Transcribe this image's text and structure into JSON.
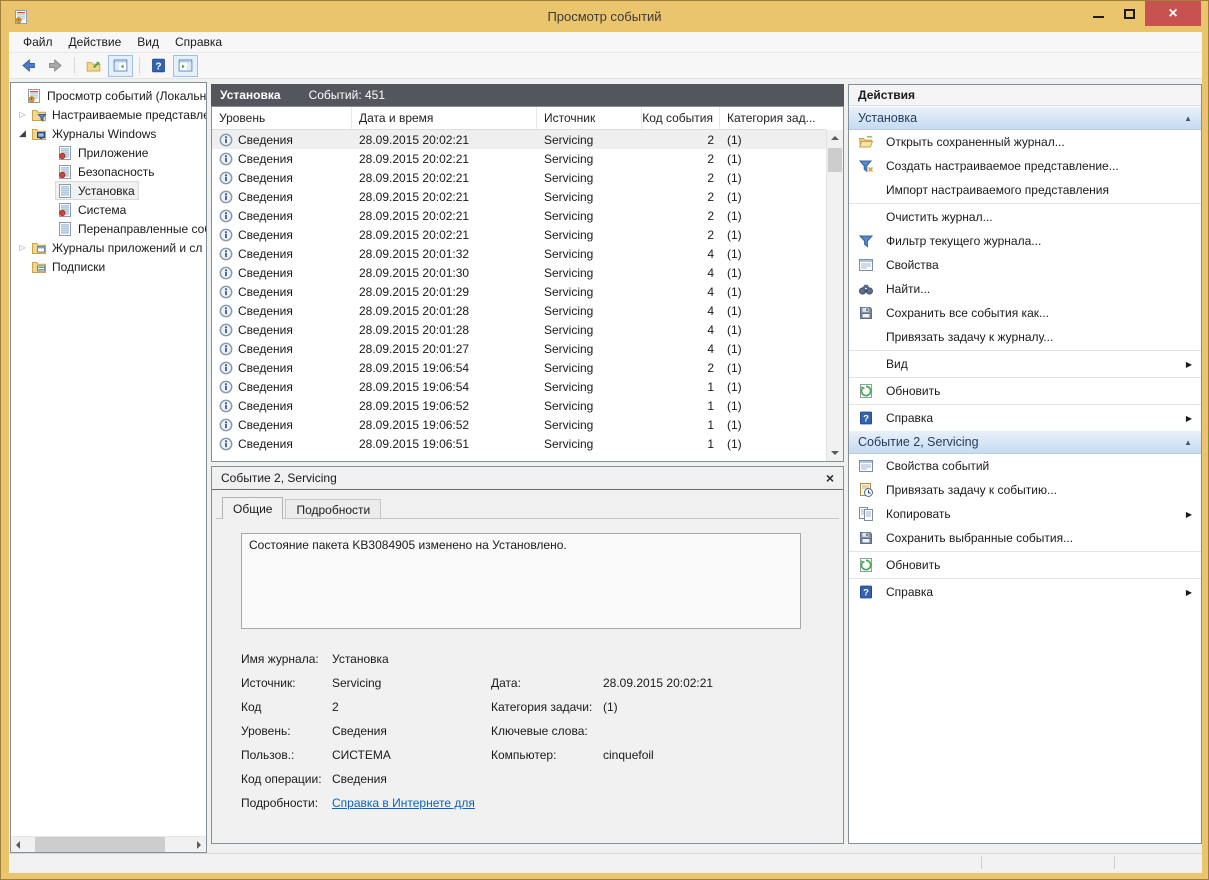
{
  "window": {
    "title": "Просмотр событий"
  },
  "menu": {
    "items": [
      "Файл",
      "Действие",
      "Вид",
      "Справка"
    ]
  },
  "toolbar": {
    "buttons": [
      {
        "icon": "back-icon"
      },
      {
        "icon": "forward-icon"
      },
      {
        "sep": true
      },
      {
        "icon": "export-log-icon"
      },
      {
        "icon": "console-tree-icon",
        "highlighted": true
      },
      {
        "sep": true
      },
      {
        "icon": "help-icon"
      },
      {
        "icon": "action-pane-icon",
        "highlighted": true
      }
    ]
  },
  "tree": {
    "items": [
      {
        "level": 0,
        "icon": "event-viewer-icon",
        "label": "Просмотр событий (Локальнь"
      },
      {
        "level": 1,
        "collapsed": true,
        "icon": "custom-views-folder-icon",
        "label": "Настраиваемые представле"
      },
      {
        "level": 1,
        "expanded": true,
        "icon": "windows-logs-folder-icon",
        "label": "Журналы Windows"
      },
      {
        "level": 2,
        "icon": "event-log-marked-icon",
        "label": "Приложение"
      },
      {
        "level": 2,
        "icon": "event-log-marked-icon",
        "label": "Безопасность"
      },
      {
        "level": 2,
        "icon": "event-log-icon",
        "label": "Установка",
        "selected": true
      },
      {
        "level": 2,
        "icon": "event-log-marked-icon",
        "label": "Система"
      },
      {
        "level": 2,
        "icon": "event-log-icon",
        "label": "Перенаправленные соб"
      },
      {
        "level": 1,
        "collapsed": true,
        "icon": "app-logs-folder-icon",
        "label": "Журналы приложений и сл"
      },
      {
        "level": 1,
        "icon": "subscriptions-icon",
        "label": "Подписки"
      }
    ]
  },
  "events": {
    "log_name": "Установка",
    "count_label": "Событий: 451",
    "columns": [
      "Уровень",
      "Дата и время",
      "Источник",
      "Код события",
      "Категория зад..."
    ],
    "rows": [
      {
        "icon": "info-icon",
        "level": "Сведения",
        "datetime": "28.09.2015 20:02:21",
        "source": "Servicing",
        "code": "2",
        "category": "(1)",
        "selected": true
      },
      {
        "icon": "info-icon",
        "level": "Сведения",
        "datetime": "28.09.2015 20:02:21",
        "source": "Servicing",
        "code": "2",
        "category": "(1)"
      },
      {
        "icon": "info-icon",
        "level": "Сведения",
        "datetime": "28.09.2015 20:02:21",
        "source": "Servicing",
        "code": "2",
        "category": "(1)"
      },
      {
        "icon": "info-icon",
        "level": "Сведения",
        "datetime": "28.09.2015 20:02:21",
        "source": "Servicing",
        "code": "2",
        "category": "(1)"
      },
      {
        "icon": "info-icon",
        "level": "Сведения",
        "datetime": "28.09.2015 20:02:21",
        "source": "Servicing",
        "code": "2",
        "category": "(1)"
      },
      {
        "icon": "info-icon",
        "level": "Сведения",
        "datetime": "28.09.2015 20:02:21",
        "source": "Servicing",
        "code": "2",
        "category": "(1)"
      },
      {
        "icon": "info-icon",
        "level": "Сведения",
        "datetime": "28.09.2015 20:01:32",
        "source": "Servicing",
        "code": "4",
        "category": "(1)"
      },
      {
        "icon": "info-icon",
        "level": "Сведения",
        "datetime": "28.09.2015 20:01:30",
        "source": "Servicing",
        "code": "4",
        "category": "(1)"
      },
      {
        "icon": "info-icon",
        "level": "Сведения",
        "datetime": "28.09.2015 20:01:29",
        "source": "Servicing",
        "code": "4",
        "category": "(1)"
      },
      {
        "icon": "info-icon",
        "level": "Сведения",
        "datetime": "28.09.2015 20:01:28",
        "source": "Servicing",
        "code": "4",
        "category": "(1)"
      },
      {
        "icon": "info-icon",
        "level": "Сведения",
        "datetime": "28.09.2015 20:01:28",
        "source": "Servicing",
        "code": "4",
        "category": "(1)"
      },
      {
        "icon": "info-icon",
        "level": "Сведения",
        "datetime": "28.09.2015 20:01:27",
        "source": "Servicing",
        "code": "4",
        "category": "(1)"
      },
      {
        "icon": "info-icon",
        "level": "Сведения",
        "datetime": "28.09.2015 19:06:54",
        "source": "Servicing",
        "code": "2",
        "category": "(1)"
      },
      {
        "icon": "info-icon",
        "level": "Сведения",
        "datetime": "28.09.2015 19:06:54",
        "source": "Servicing",
        "code": "1",
        "category": "(1)"
      },
      {
        "icon": "info-icon",
        "level": "Сведения",
        "datetime": "28.09.2015 19:06:52",
        "source": "Servicing",
        "code": "1",
        "category": "(1)"
      },
      {
        "icon": "info-icon",
        "level": "Сведения",
        "datetime": "28.09.2015 19:06:52",
        "source": "Servicing",
        "code": "1",
        "category": "(1)"
      },
      {
        "icon": "info-icon",
        "level": "Сведения",
        "datetime": "28.09.2015 19:06:51",
        "source": "Servicing",
        "code": "1",
        "category": "(1)"
      }
    ]
  },
  "details": {
    "title": "Событие 2, Servicing",
    "tabs": [
      {
        "label": "Общие",
        "active": true
      },
      {
        "label": "Подробности",
        "active": false
      }
    ],
    "message": "Состояние пакета KB3084905 изменено на Установлено.",
    "fields": [
      {
        "label": "Имя журнала:",
        "value": "Установка",
        "label2": "",
        "value2": ""
      },
      {
        "label": "Источник:",
        "value": "Servicing",
        "label2": "Дата:",
        "value2": "28.09.2015 20:02:21"
      },
      {
        "label": "Код",
        "value": "2",
        "label2": "Категория задачи:",
        "value2": "(1)"
      },
      {
        "label": "Уровень:",
        "value": "Сведения",
        "label2": "Ключевые слова:",
        "value2": ""
      },
      {
        "label": "Пользов.:",
        "value": "СИСТЕМА",
        "label2": "Компьютер:",
        "value2": "cinquefoil"
      },
      {
        "label": "Код операции:",
        "value": "Сведения",
        "label2": "",
        "value2": ""
      },
      {
        "label": "Подробности:",
        "value": "Справка в Интернете для ",
        "link": true,
        "label2": "",
        "value2": ""
      }
    ]
  },
  "actions": {
    "panel_title": "Действия",
    "section1": {
      "title": "Установка",
      "items": [
        {
          "icon": "open-folder-icon",
          "label": "Открыть сохраненный журнал..."
        },
        {
          "icon": "create-view-icon",
          "label": "Создать настраиваемое представление..."
        },
        {
          "icon": "",
          "label": "Импорт настраиваемого представления",
          "separator_after": true
        },
        {
          "icon": "",
          "label": "Очистить журнал..."
        },
        {
          "icon": "filter-icon",
          "label": "Фильтр текущего журнала..."
        },
        {
          "icon": "properties-icon",
          "label": "Свойства"
        },
        {
          "icon": "find-icon",
          "label": "Найти..."
        },
        {
          "icon": "save-icon",
          "label": "Сохранить все события как..."
        },
        {
          "icon": "",
          "label": "Привязать задачу к журналу...",
          "separator_after": true
        },
        {
          "icon": "",
          "label": "Вид",
          "submenu": true,
          "separator_after": true
        },
        {
          "icon": "refresh-icon",
          "label": "Обновить",
          "separator_after": true
        },
        {
          "icon": "help-icon",
          "label": "Справка",
          "submenu": true
        }
      ]
    },
    "section2": {
      "title": "Событие 2, Servicing",
      "items": [
        {
          "icon": "properties-icon",
          "label": "Свойства событий"
        },
        {
          "icon": "attach-task-icon",
          "label": "Привязать задачу к событию..."
        },
        {
          "icon": "copy-icon",
          "label": "Копировать",
          "submenu": true
        },
        {
          "icon": "save-icon",
          "label": "Сохранить выбранные события...",
          "separator_after": true
        },
        {
          "icon": "refresh-icon",
          "label": "Обновить",
          "separator_after": true
        },
        {
          "icon": "help-icon",
          "label": "Справка",
          "submenu": true
        }
      ]
    }
  }
}
